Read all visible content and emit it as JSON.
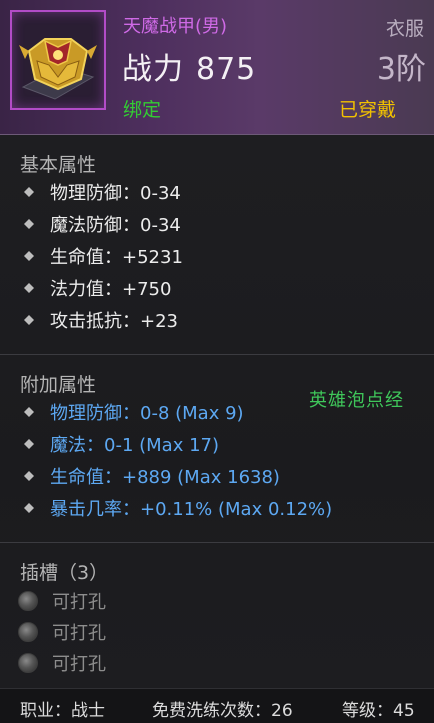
{
  "item": {
    "name": "天魔战甲(男)",
    "power_label": "战力",
    "power_value": "875",
    "slot_type": "衣服",
    "tier": "3阶",
    "bind_status": "绑定",
    "equip_status": "已穿戴",
    "icon": "golden-armor-chest-icon"
  },
  "base_attributes": {
    "title": "基本属性",
    "items": [
      "物理防御：0-34",
      "魔法防御：0-34",
      "生命值：+5231",
      "法力值：+750",
      "攻击抵抗：+23"
    ]
  },
  "bonus_attributes": {
    "title": "附加属性",
    "items": [
      "物理防御：0-8 (Max 9)",
      "魔法：0-1 (Max 17)",
      "生命值：+889 (Max 1638)",
      "暴击几率：+0.11% (Max 0.12%)"
    ]
  },
  "side_note": "英雄泡点经",
  "sockets": {
    "title": "插槽（3）",
    "items": [
      "可打孔",
      "可打孔",
      "可打孔"
    ]
  },
  "footer": {
    "class": "职业：战士",
    "refine": "免费洗练次数：26",
    "level": "等级：45"
  },
  "colors": {
    "name": "#cf6ae6",
    "bound": "#33cc33",
    "equipped": "#f2c200",
    "bonus_attr": "#5da8f2",
    "side_note": "#3fc65a"
  }
}
